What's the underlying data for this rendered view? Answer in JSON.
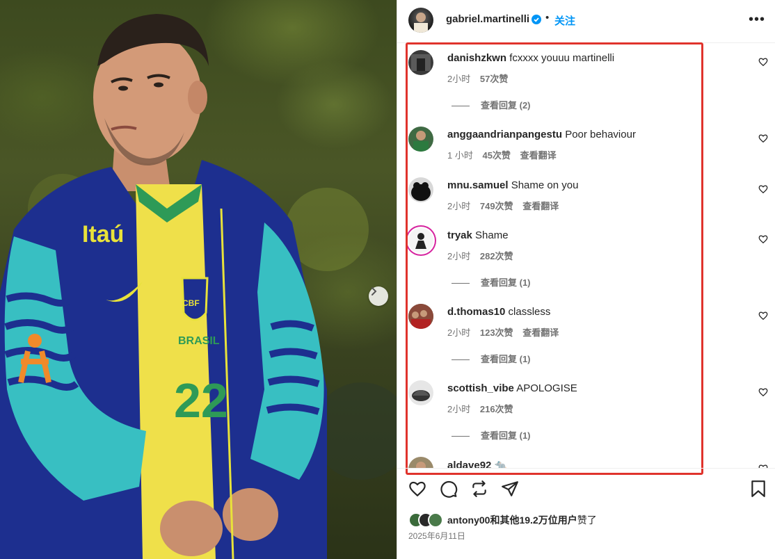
{
  "post": {
    "username": "gabriel.martinelli",
    "follow_label": "关注",
    "more_label": "•••",
    "date": "2025年6月11日"
  },
  "photo": {
    "jersey_number": "22",
    "sponsor_text": "Itaú",
    "country_text": "BRASIL",
    "badge_text": "CBF"
  },
  "comments": [
    {
      "user": "danishzkwn",
      "text": "fcxxxx youuu martinelli",
      "time": "2小时",
      "likes": "57次赞",
      "translate": "",
      "replies": "查看回复 (2)"
    },
    {
      "user": "anggaandrianpangestu",
      "text": "Poor behaviour",
      "time": "1 小时",
      "likes": "45次赞",
      "translate": "查看翻译",
      "replies": ""
    },
    {
      "user": "mnu.samuel",
      "text": "Shame on you",
      "time": "2小时",
      "likes": "749次赞",
      "translate": "查看翻译",
      "replies": ""
    },
    {
      "user": "tryak",
      "text": "Shame",
      "time": "2小时",
      "likes": "282次赞",
      "translate": "",
      "replies": "查看回复 (1)"
    },
    {
      "user": "d.thomas10",
      "text": "classless",
      "time": "2小时",
      "likes": "123次赞",
      "translate": "查看翻译",
      "replies": "查看回复 (1)"
    },
    {
      "user": "scottish_vibe",
      "text": "APOLOGISE",
      "time": "2小时",
      "likes": "216次赞",
      "translate": "",
      "replies": "查看回复 (1)"
    },
    {
      "user": "aldave92",
      "text": "🐀",
      "time": "",
      "likes": "",
      "translate": "",
      "replies": ""
    }
  ],
  "likes_summary": {
    "prefix": "antony00和",
    "rest": "其他19.2万位用户",
    "suffix": "赞了"
  },
  "icons": {
    "header": [
      "avatar",
      "verified-badge-icon",
      "more-options-icon"
    ],
    "actions": [
      "heart-icon",
      "comment-icon",
      "share-icon",
      "send-icon",
      "bookmark-icon"
    ],
    "carousel": "chevron-right-icon"
  },
  "colors": {
    "accent": "#0095f6",
    "highlight": "#e0332c",
    "secondary_text": "#737373"
  }
}
